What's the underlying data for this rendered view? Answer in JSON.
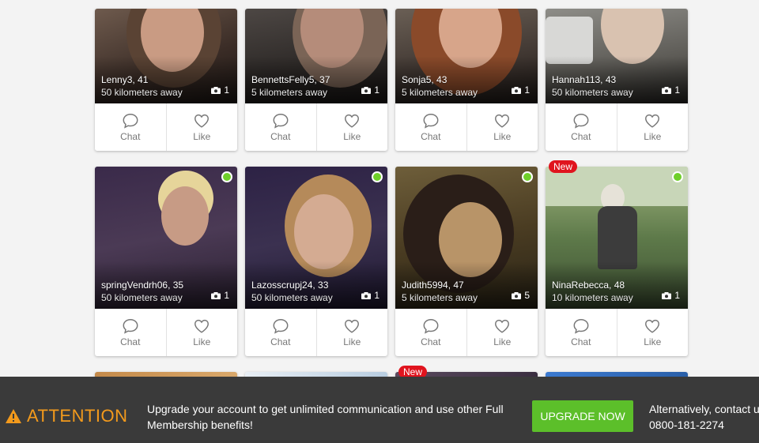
{
  "profiles": [
    {
      "name": "Lenny3",
      "age": ", 41",
      "distance": "50 kilometers away",
      "photos": "1",
      "online": false,
      "new": false
    },
    {
      "name": "BennettsFelly5",
      "age": ", 37",
      "distance": "5 kilometers away",
      "photos": "1",
      "online": false,
      "new": false
    },
    {
      "name": "Sonja5",
      "age": ", 43",
      "distance": "5 kilometers away",
      "photos": "1",
      "online": false,
      "new": false
    },
    {
      "name": "Hannah113",
      "age": ", 43",
      "distance": "50 kilometers away",
      "photos": "1",
      "online": false,
      "new": false
    },
    {
      "name": "springVendrh06",
      "age": ", 35",
      "distance": "50 kilometers away",
      "photos": "1",
      "online": true,
      "new": false
    },
    {
      "name": "Lazosscrupj24",
      "age": ", 33",
      "distance": "50 kilometers away",
      "photos": "1",
      "online": true,
      "new": false
    },
    {
      "name": "Judith5994",
      "age": ", 47",
      "distance": "5 kilometers away",
      "photos": "5",
      "online": true,
      "new": false
    },
    {
      "name": "NinaRebecca",
      "age": ", 48",
      "distance": "10 kilometers away",
      "photos": "1",
      "online": true,
      "new": true
    }
  ],
  "card_actions": {
    "chat": "Chat",
    "like": "Like"
  },
  "badge_new": "New",
  "banner": {
    "attention": "ATTENTION",
    "message": "Upgrade your account to get unlimited communication and use other Full Membership benefits!",
    "upgrade_button": "UPGRADE NOW",
    "alt_line1": "Alternatively, contact u",
    "alt_phone": "0800-181-2274"
  },
  "colors": {
    "online": "#6fcf2a",
    "new_badge": "#e0141e",
    "attention": "#f39a1c",
    "upgrade": "#5cbf2a",
    "banner_bg": "#3a3a3a"
  }
}
